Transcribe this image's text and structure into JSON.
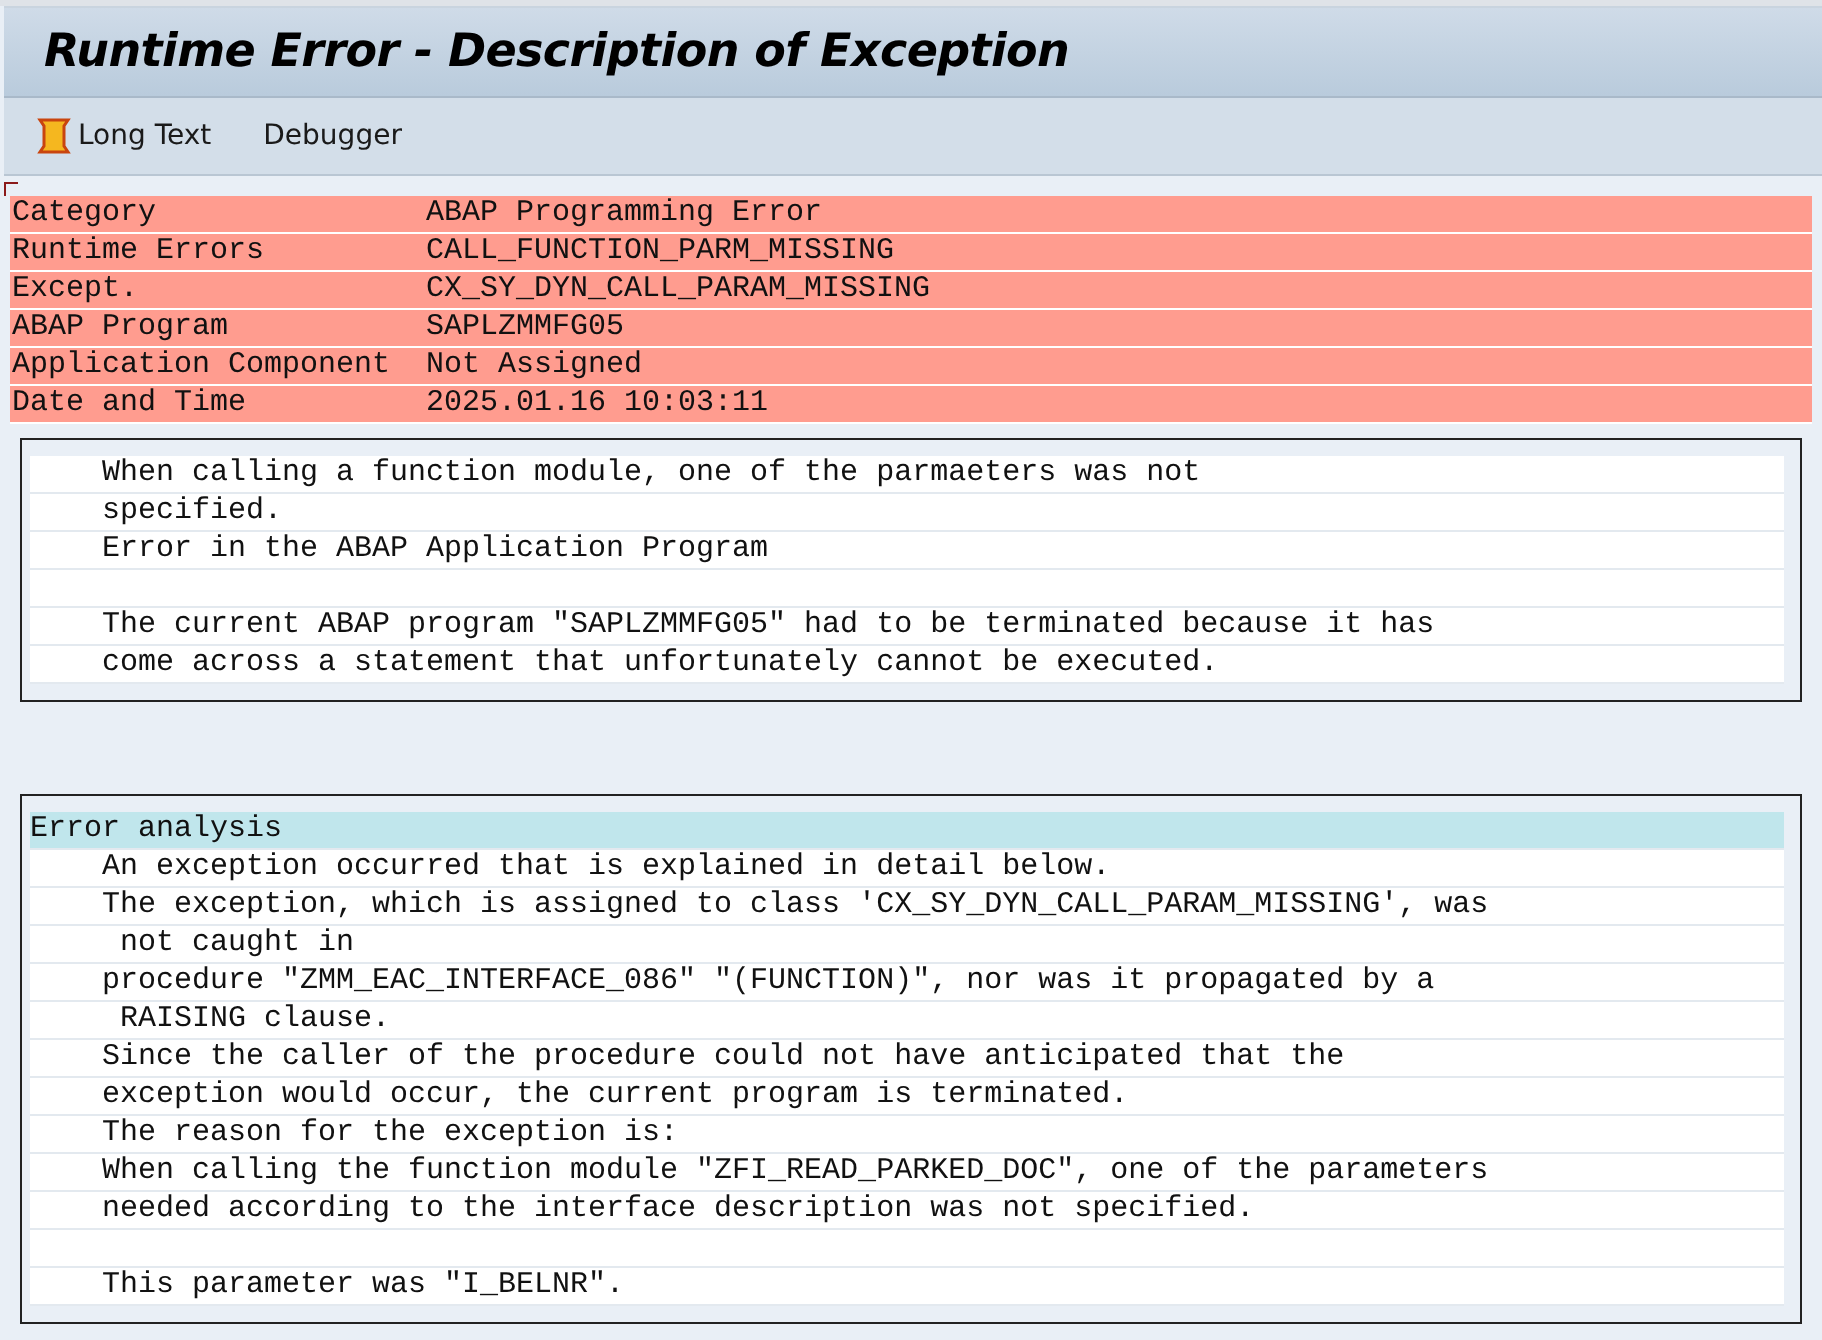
{
  "window": {
    "title": "Runtime Error - Description of Exception"
  },
  "toolbar": [
    {
      "label": "Long Text",
      "kind": "icon"
    },
    {
      "label": "Debugger",
      "kind": "plain"
    }
  ],
  "summary": [
    {
      "label": "Category",
      "value": "ABAP Programming Error"
    },
    {
      "label": "Runtime Errors",
      "value": "CALL_FUNCTION_PARM_MISSING"
    },
    {
      "label": "Except.",
      "value": "CX_SY_DYN_CALL_PARAM_MISSING"
    },
    {
      "label": "ABAP Program",
      "value": "SAPLZMMFG05"
    },
    {
      "label": "Application Component",
      "value": "Not Assigned"
    },
    {
      "label": "Date and Time",
      "value": "2025.01.16 10:03:11"
    }
  ],
  "short_text": [
    {
      "kind": "body",
      "text": "When calling a function module, one of the parmaeters was not"
    },
    {
      "kind": "body",
      "text": "specified."
    },
    {
      "kind": "body",
      "text": "Error in the ABAP Application Program"
    },
    {
      "kind": "blank"
    },
    {
      "kind": "body",
      "text": "The current ABAP program \"SAPLZMMFG05\" had to be terminated because it has"
    },
    {
      "kind": "body",
      "text": "come across a statement that unfortunately cannot be executed."
    }
  ],
  "error_analysis": [
    {
      "kind": "heading",
      "text": "Error analysis"
    },
    {
      "kind": "body",
      "text": "An exception occurred that is explained in detail below."
    },
    {
      "kind": "body",
      "text": "The exception, which is assigned to class 'CX_SY_DYN_CALL_PARAM_MISSING', was"
    },
    {
      "kind": "continued",
      "text": "not caught in"
    },
    {
      "kind": "body",
      "text": "procedure \"ZMM_EAC_INTERFACE_086\" \"(FUNCTION)\", nor was it propagated by a"
    },
    {
      "kind": "continued",
      "text": "RAISING clause."
    },
    {
      "kind": "body",
      "text": "Since the caller of the procedure could not have anticipated that the"
    },
    {
      "kind": "body",
      "text": "exception would occur, the current program is terminated."
    },
    {
      "kind": "body",
      "text": "The reason for the exception is:"
    },
    {
      "kind": "body",
      "text": "When calling the function module \"ZFI_READ_PARKED_DOC\", one of the parameters"
    },
    {
      "kind": "body",
      "text": "needed according to the interface description was not specified."
    },
    {
      "kind": "blank"
    },
    {
      "kind": "body",
      "text": "This parameter was \"I_BELNR\"."
    }
  ]
}
